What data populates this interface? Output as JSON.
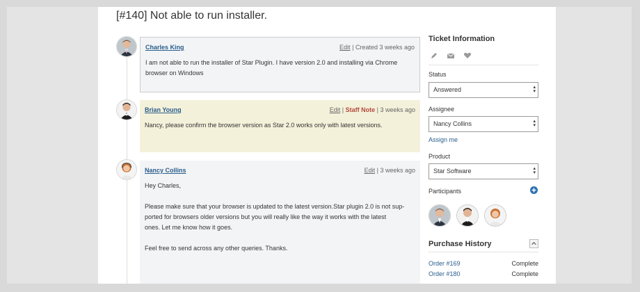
{
  "ticket": {
    "title": "[#140] Not able to run installer."
  },
  "thread": [
    {
      "author": "Charles King",
      "edit": "Edit",
      "sep": "|",
      "time": "Created 3 weeks ago",
      "body": [
        "I am not able to run the installer of Star Plugin. I have version 2.0 and installing via Chrome",
        "browser on Windows"
      ]
    },
    {
      "author": "Brian Young",
      "edit": "Edit",
      "sep": "|",
      "staff_note": "Staff Note",
      "sep2": "|",
      "time": "3 weeks ago",
      "body": [
        "Nancy, please confirm the browser version as Star 2.0 works only with latest versions."
      ]
    },
    {
      "author": "Nancy Collins",
      "edit": "Edit",
      "sep": "|",
      "time": "3 weeks ago",
      "body": [
        "Hey Charles,",
        "Please make sure that your browser is updated to the latest version.Star plugin 2.0 is not sup-",
        "ported for browsers older versions but  you will really like the way it works with the latest",
        "ones. Let me know how it goes.",
        "Feel free to send across any other queries.  Thanks."
      ]
    }
  ],
  "sidebar": {
    "heading": "Ticket Information",
    "icons": [
      "pencil-icon",
      "envelope-icon",
      "heart-icon"
    ],
    "status_label": "Status",
    "status_value": "Answered",
    "assignee_label": "Assignee",
    "assignee_value": "Nancy Collins",
    "assign_me": "Assign me",
    "product_label": "Product",
    "product_value": "Star Software",
    "participants_label": "Participants",
    "purchase_heading": "Purchase History",
    "orders": [
      {
        "id": "Order #169",
        "status": "Complete"
      },
      {
        "id": "Order #180",
        "status": "Complete"
      }
    ]
  },
  "colors": {
    "link": "#2a5e8c",
    "staff_note": "#b44a3e",
    "note_bg": "#f4f1da",
    "add_icon": "#2a6fb0"
  }
}
